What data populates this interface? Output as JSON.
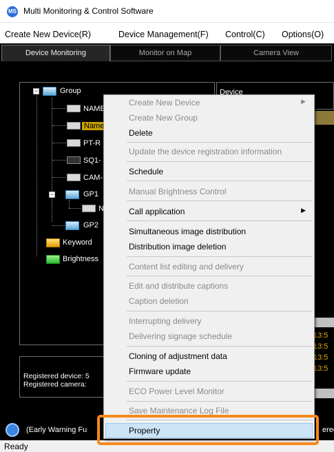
{
  "window": {
    "title": "Multi Monitoring & Control Software",
    "icon": "app-logo-icon"
  },
  "menubar": {
    "items": [
      "Create New Device(R)",
      "Device Management(F)",
      "Control(C)",
      "Options(O)"
    ]
  },
  "tabs": [
    "Device Monitoring",
    "Monitor on Map",
    "Camera View"
  ],
  "tree": {
    "group": "Group",
    "items": [
      "NAME",
      "Name",
      "PT-R",
      "SQ1-",
      "CAM-",
      "GP1",
      "N",
      "GP2"
    ],
    "keyword": "Keyword",
    "brightness": "Brightness"
  },
  "device_panel": {
    "header": "Device"
  },
  "times": [
    "13:5",
    "13:5",
    "13:5",
    "13:5"
  ],
  "info": {
    "registered_device": "Registered device: 5",
    "registered_camera": "Registered camera:"
  },
  "status_strip": {
    "text": "(Early Warning Fu",
    "right": "ered"
  },
  "statusbar": {
    "text": "Ready"
  },
  "context_menu": {
    "items": [
      {
        "label": "Create New Device",
        "enabled": false,
        "submenu": true
      },
      {
        "label": "Create New Group",
        "enabled": false
      },
      {
        "label": "Delete",
        "enabled": true
      },
      {
        "label": "Update the device registration information",
        "enabled": false
      },
      {
        "label": "Schedule",
        "enabled": true
      },
      {
        "label": "Manual Brightness Control",
        "enabled": false
      },
      {
        "label": "Call application",
        "enabled": true,
        "submenu": true
      },
      {
        "label": "Simultaneous image distribution",
        "enabled": true
      },
      {
        "label": "Distribution image deletion",
        "enabled": true
      },
      {
        "label": "Content list editing and delivery",
        "enabled": false
      },
      {
        "label": "Edit and distribute captions",
        "enabled": false
      },
      {
        "label": "Caption deletion",
        "enabled": false
      },
      {
        "label": "Interrupting delivery",
        "enabled": false
      },
      {
        "label": "Delivering signage schedule",
        "enabled": false
      },
      {
        "label": "Cloning of adjustment data",
        "enabled": true
      },
      {
        "label": "Firmware update",
        "enabled": true
      },
      {
        "label": "ECO Power Level Monitor",
        "enabled": false
      },
      {
        "label": "Save Maintenance Log File",
        "enabled": false
      },
      {
        "label": "Property",
        "enabled": true,
        "highlighted": true
      }
    ]
  },
  "colors": {
    "highlight_ring": "#f5891d",
    "selected_row": "#c8a000",
    "time_text": "#e3a800",
    "menu_hover": "#cce4f7"
  }
}
